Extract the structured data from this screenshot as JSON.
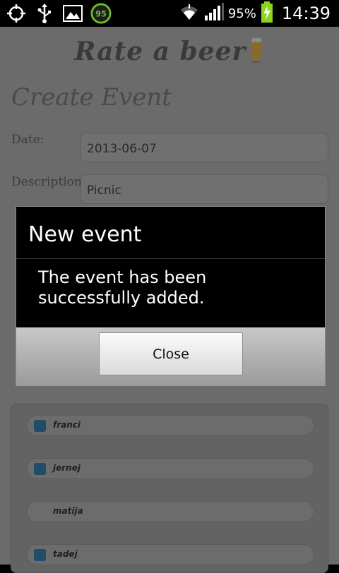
{
  "status_bar": {
    "icons": [
      "gps-icon",
      "usb-icon",
      "gallery-icon",
      "battery-app-icon"
    ],
    "battery_app_value": "95",
    "battery_percent": "95%",
    "time": "14:39"
  },
  "app": {
    "title": "Rate a beer",
    "page_title": "Create Event",
    "form": {
      "date_label": "Date:",
      "date_value": "2013-06-07",
      "description_label": "Description",
      "description_value": "Picnic"
    },
    "users": [
      {
        "name": "franci",
        "checked": true
      },
      {
        "name": "jernej",
        "checked": true
      },
      {
        "name": "matija",
        "checked": false
      },
      {
        "name": "tadej",
        "checked": true
      }
    ]
  },
  "dialog": {
    "title": "New event",
    "message": "The event has been successfully added.",
    "close_label": "Close"
  }
}
